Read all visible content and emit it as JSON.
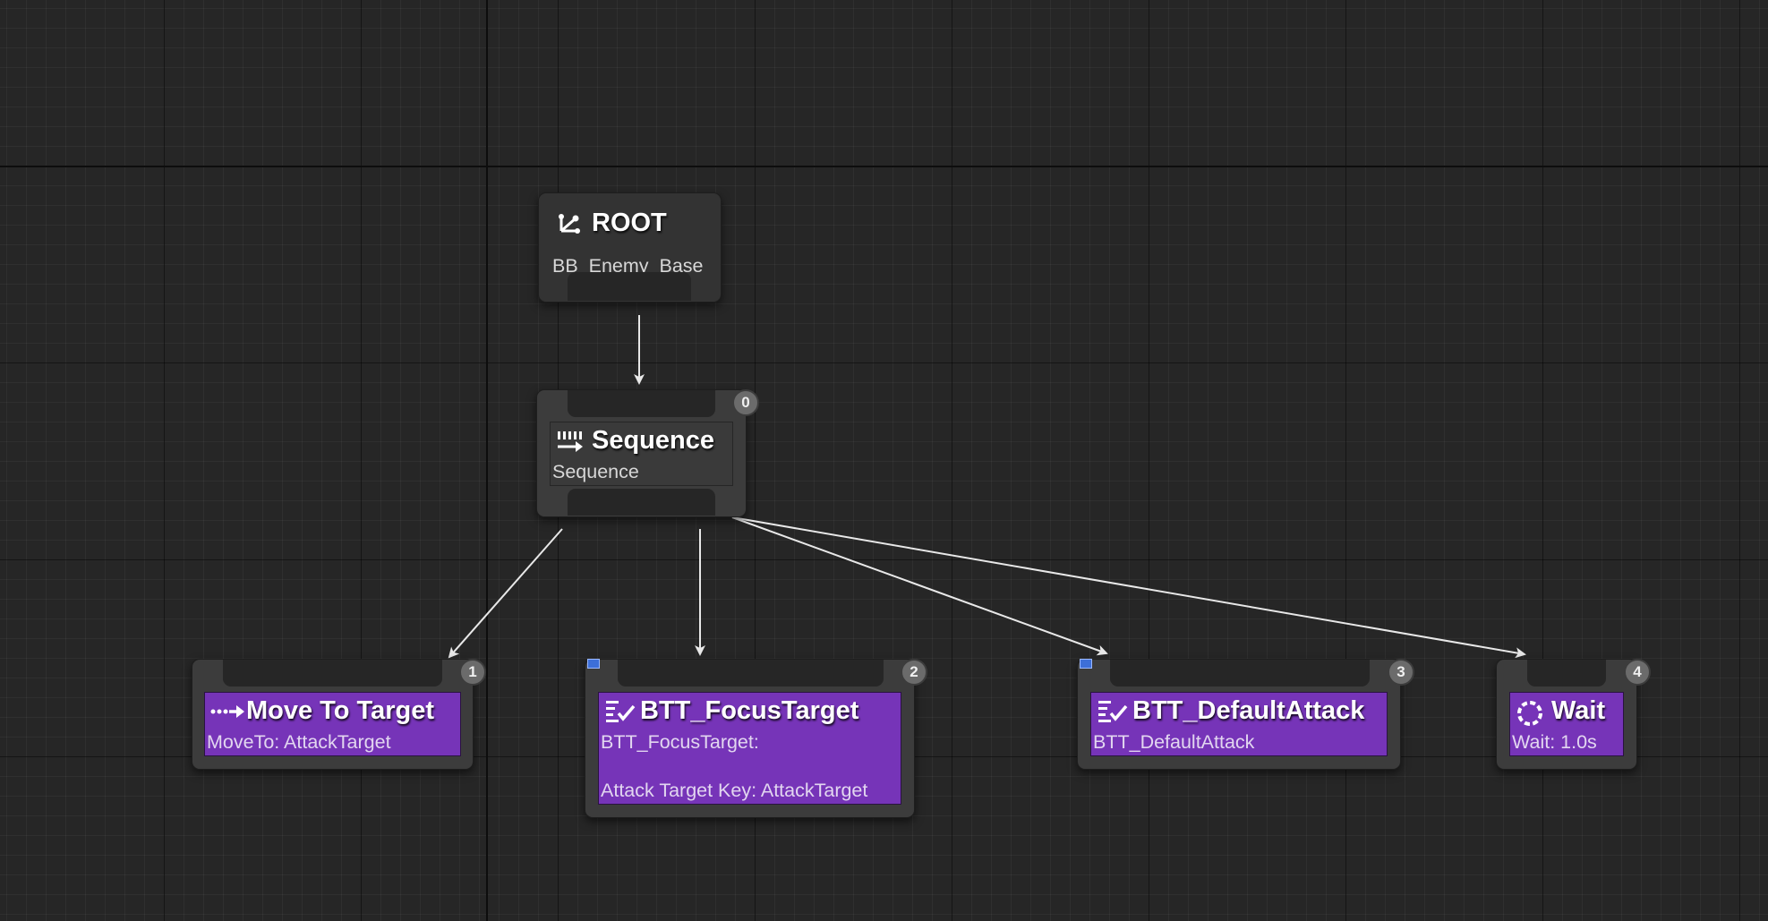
{
  "graph": {
    "root": {
      "title": "ROOT",
      "subtitle": "BB_Enemy_Base",
      "icon": "root-icon"
    },
    "sequence": {
      "title": "Sequence",
      "subtitle": "Sequence",
      "index": "0",
      "icon": "sequence-icon"
    },
    "tasks": [
      {
        "title": "Move To Target",
        "subtitle": "MoveTo: AttackTarget",
        "index": "1",
        "icon": "move-to-icon"
      },
      {
        "title": "BTT_FocusTarget",
        "subtitle": "BTT_FocusTarget:",
        "detail": "Attack Target Key: AttackTarget",
        "index": "2",
        "icon": "task-icon"
      },
      {
        "title": "BTT_DefaultAttack",
        "subtitle": "BTT_DefaultAttack",
        "index": "3",
        "icon": "task-icon"
      },
      {
        "title": "Wait",
        "subtitle": "Wait: 1.0s",
        "index": "4",
        "icon": "wait-icon"
      }
    ],
    "colors": {
      "background": "#262626",
      "task_body": "#7634b8",
      "composite_body": "#3a3a3a",
      "wire": "#e8e8e8",
      "breakpoint_marker": "#3d6fd8"
    }
  }
}
